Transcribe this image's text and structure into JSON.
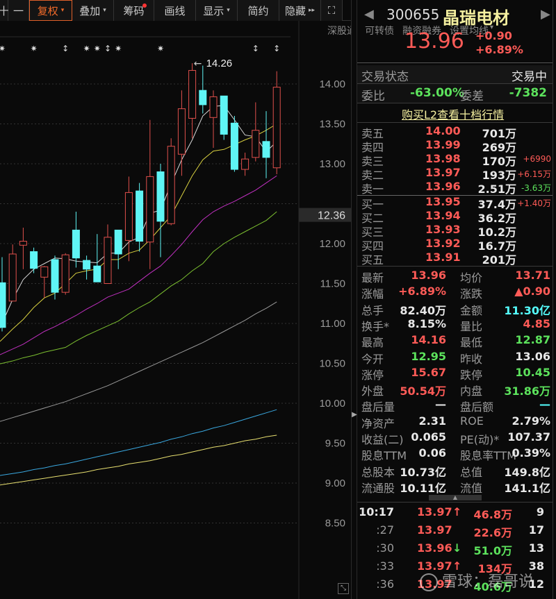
{
  "toolbar": {
    "items": [
      {
        "label": "十"
      },
      {
        "label": "一"
      },
      {
        "label": "复权",
        "caret": "▾"
      },
      {
        "label": "叠加",
        "caret": "▾"
      },
      {
        "label": "筹码"
      },
      {
        "label": "画线"
      },
      {
        "label": "显示",
        "caret": "▾"
      },
      {
        "label": "简约"
      },
      {
        "label": "隐藏",
        "caret": "▸▸"
      }
    ],
    "fullscreen_icon": "⛶"
  },
  "subbar": {
    "items": [
      "深股通",
      "可转债",
      "融资融券",
      "设置均线"
    ],
    "caret": "▾"
  },
  "chart_data": {
    "type": "candlestick",
    "y_ticks": [
      "14.00",
      "13.50",
      "13.00",
      "12.00",
      "11.50",
      "11.00",
      "10.50",
      "10.00",
      "9.50",
      "9.00",
      "8.50"
    ],
    "y_tick_values": [
      14,
      13.5,
      13,
      12,
      11.5,
      11,
      10.5,
      10,
      9.5,
      9,
      8.5
    ],
    "current_price_label": "12.36",
    "current_price": 12.36,
    "high_annotation": "14.26",
    "high_value": 14.26,
    "candles": [
      [
        11.51,
        10.95,
        11.83,
        10.9
      ],
      [
        11.28,
        11.87,
        11.99,
        11.28
      ],
      [
        11.98,
        12.03,
        12.2,
        11.68
      ],
      [
        11.9,
        11.69,
        11.95,
        11.63
      ],
      [
        11.58,
        11.71,
        11.72,
        11.32
      ],
      [
        11.8,
        11.39,
        11.85,
        11.3
      ],
      [
        11.39,
        11.86,
        11.88,
        11.36
      ],
      [
        12.17,
        11.82,
        12.4,
        11.7
      ],
      [
        11.79,
        11.68,
        11.85,
        11.55
      ],
      [
        11.72,
        11.52,
        12.12,
        11.52
      ],
      [
        11.5,
        12.08,
        12.24,
        11.5
      ],
      [
        12.17,
        11.87,
        12.17,
        11.68
      ],
      [
        12.04,
        12.64,
        12.84,
        11.78
      ],
      [
        12.66,
        12.03,
        12.76,
        11.9
      ],
      [
        12.02,
        12.84,
        13.55,
        11.68
      ],
      [
        12.9,
        12.28,
        13.0,
        11.83
      ],
      [
        12.25,
        13.22,
        13.32,
        12.23
      ],
      [
        13.12,
        13.69,
        13.92,
        12.85
      ],
      [
        13.57,
        14.17,
        14.26,
        13.32
      ],
      [
        13.92,
        13.74,
        14.23,
        13.63
      ],
      [
        13.58,
        13.84,
        13.92,
        13.2
      ],
      [
        13.85,
        13.37,
        13.85,
        13.3
      ],
      [
        13.51,
        12.93,
        13.6,
        12.9
      ],
      [
        12.93,
        13.06,
        13.14,
        12.85
      ],
      [
        13.08,
        13.42,
        13.77,
        13.03
      ],
      [
        13.28,
        13.08,
        13.66,
        12.82
      ],
      [
        12.95,
        13.96,
        14.16,
        12.87
      ]
    ],
    "ma": [
      {
        "name": "MA5",
        "color": "#d8d8d8",
        "values": [
          11.0,
          11.3,
          11.55,
          11.68,
          11.75,
          11.82,
          11.81,
          11.78,
          11.77,
          11.76,
          11.88,
          11.88,
          12.02,
          12.08,
          12.38,
          12.42,
          12.75,
          13.05,
          13.3,
          13.6,
          13.72,
          13.73,
          13.55,
          13.36,
          13.34,
          13.15,
          13.28
        ]
      },
      {
        "name": "MA10",
        "color": "#d8d040",
        "values": [
          10.8,
          10.93,
          11.05,
          11.2,
          11.32,
          11.38,
          11.5,
          11.63,
          11.66,
          11.68,
          11.8,
          11.8,
          11.88,
          11.92,
          12.05,
          12.2,
          12.35,
          12.6,
          12.85,
          13.05,
          13.16,
          13.18,
          13.24,
          13.3,
          13.35,
          13.42,
          13.5
        ]
      },
      {
        "name": "MA20",
        "color": "#c030c0",
        "values": [
          10.62,
          10.68,
          10.74,
          10.82,
          10.9,
          10.96,
          11.03,
          11.1,
          11.18,
          11.25,
          11.33,
          11.38,
          11.43,
          11.53,
          11.63,
          11.72,
          11.85,
          11.99,
          12.15,
          12.3,
          12.4,
          12.47,
          12.53,
          12.6,
          12.67,
          12.76,
          12.85
        ]
      },
      {
        "name": "MA30",
        "color": "#7cc030",
        "values": [
          10.5,
          10.53,
          10.57,
          10.6,
          10.64,
          10.67,
          10.7,
          10.78,
          10.85,
          10.91,
          10.97,
          11.03,
          11.12,
          11.2,
          11.27,
          11.37,
          11.47,
          11.55,
          11.66,
          11.75,
          11.9,
          12.0,
          12.08,
          12.15,
          12.22,
          12.29,
          12.4
        ]
      },
      {
        "name": "MA60",
        "color": "#9a9a9a",
        "values": [
          9.78,
          9.82,
          9.86,
          9.9,
          9.94,
          9.98,
          10.02,
          10.07,
          10.12,
          10.17,
          10.22,
          10.28,
          10.34,
          10.4,
          10.46,
          10.52,
          10.58,
          10.64,
          10.7,
          10.76,
          10.83,
          10.9,
          10.97,
          11.04,
          11.12,
          11.19,
          11.27
        ]
      },
      {
        "name": "MA120",
        "color": "#3aa8e0",
        "values": [
          9.1,
          9.12,
          9.14,
          9.17,
          9.19,
          9.22,
          9.24,
          9.27,
          9.3,
          9.33,
          9.36,
          9.39,
          9.42,
          9.45,
          9.48,
          9.51,
          9.55,
          9.58,
          9.62,
          9.65,
          9.69,
          9.72,
          9.76,
          9.8,
          9.84,
          9.88,
          9.92
        ]
      },
      {
        "name": "MA250",
        "color": "#e8e070",
        "values": [
          8.98,
          9.0,
          9.02,
          9.04,
          9.06,
          9.08,
          9.1,
          9.12,
          9.14,
          9.17,
          9.19,
          9.21,
          9.24,
          9.26,
          9.28,
          9.31,
          9.34,
          9.36,
          9.39,
          9.42,
          9.45,
          9.47,
          9.5,
          9.53,
          9.55,
          9.58,
          9.6
        ]
      }
    ],
    "markers": [
      {
        "i": 0,
        "s": "✷"
      },
      {
        "i": 3,
        "s": "✷"
      },
      {
        "i": 6,
        "s": "↕"
      },
      {
        "i": 8,
        "s": "✷"
      },
      {
        "i": 9,
        "s": "✷"
      },
      {
        "i": 10,
        "s": "↕"
      },
      {
        "i": 11,
        "s": "✷"
      },
      {
        "i": 15,
        "s": "✷"
      },
      {
        "i": 24,
        "s": "↕"
      },
      {
        "i": 26,
        "s": "↕"
      }
    ],
    "up_color": "#e0504c",
    "down_color": "#5ff5f5"
  },
  "quote": {
    "code": "300655",
    "name": "晶瑞电材",
    "price": "13.96",
    "change": "+0.90",
    "change_pct": "+6.89%",
    "prev_icon": "◀",
    "next_icon": "▶"
  },
  "status": {
    "label": "交易状态",
    "value": "交易中"
  },
  "weibi": {
    "label": "委比",
    "value": "-63.00%",
    "diff_label": "委差",
    "diff_value": "-7382"
  },
  "l2_link": "购买L2查看十档行情",
  "orderbook": {
    "asks": [
      {
        "label": "卖五",
        "price": "14.00",
        "vol": "701万",
        "chg": ""
      },
      {
        "label": "卖四",
        "price": "13.99",
        "vol": "269万",
        "chg": ""
      },
      {
        "label": "卖三",
        "price": "13.98",
        "vol": "170万",
        "chg": "+6990"
      },
      {
        "label": "卖二",
        "price": "13.97",
        "vol": "193万",
        "chg": "+6.15万"
      },
      {
        "label": "卖一",
        "price": "13.96",
        "vol": "2.51万",
        "chg": "-3.63万"
      }
    ],
    "bids": [
      {
        "label": "买一",
        "price": "13.95",
        "vol": "37.4万",
        "chg": "+1.40万"
      },
      {
        "label": "买二",
        "price": "13.94",
        "vol": "36.2万",
        "chg": ""
      },
      {
        "label": "买三",
        "price": "13.93",
        "vol": "10.2万",
        "chg": ""
      },
      {
        "label": "买四",
        "price": "13.92",
        "vol": "16.7万",
        "chg": ""
      },
      {
        "label": "买五",
        "price": "13.91",
        "vol": "201万",
        "chg": ""
      }
    ]
  },
  "stats": [
    [
      "最新",
      "13.96",
      "red",
      "均价",
      "13.71",
      "red"
    ],
    [
      "涨幅",
      "+6.89%",
      "red",
      "涨跌",
      "▲0.90",
      "red"
    ],
    [
      "总手",
      "82.40万",
      "wh",
      "金额",
      "11.30亿",
      "cy"
    ],
    [
      "换手*",
      "8.15%",
      "wh",
      "量比",
      "4.85",
      "red"
    ],
    [
      "最高",
      "14.16",
      "red",
      "最低",
      "12.87",
      "grn"
    ],
    [
      "今开",
      "12.95",
      "grn",
      "昨收",
      "13.06",
      "wh"
    ],
    [
      "涨停",
      "15.67",
      "red",
      "跌停",
      "10.45",
      "grn"
    ],
    [
      "外盘",
      "50.54万",
      "red",
      "内盘",
      "31.86万",
      "grn"
    ],
    [
      "盘后量",
      "—",
      "wh",
      "盘后额",
      "—",
      "cy"
    ],
    [
      "净资产",
      "2.31",
      "wh",
      "ROE",
      "2.79%",
      "wh"
    ],
    [
      "收益(二)",
      "0.065",
      "wh",
      "PE(动)*",
      "107.37",
      "wh"
    ],
    [
      "股息TTM",
      "0.06",
      "wh",
      "股息率TTM",
      "0.39%",
      "wh"
    ],
    [
      "总股本",
      "10.73亿",
      "wh",
      "总值",
      "149.8亿",
      "wh"
    ],
    [
      "流通股",
      "10.11亿",
      "wh",
      "流值",
      "141.1亿",
      "wh"
    ]
  ],
  "trades": [
    {
      "time": "10:17",
      "price": "13.97",
      "arrow": "↑",
      "vol": "46.8万",
      "vc": "red",
      "n": "9"
    },
    {
      "time": ":27",
      "price": "13.97",
      "arrow": "",
      "vol": "22.6万",
      "vc": "red",
      "n": "17"
    },
    {
      "time": ":30",
      "price": "13.96",
      "arrow": "↓",
      "vol": "51.0万",
      "vc": "grn",
      "n": "13"
    },
    {
      "time": ":33",
      "price": "13.97",
      "arrow": "↑",
      "vol": "134万",
      "vc": "red",
      "n": "38"
    },
    {
      "time": ":36",
      "price": "13.97",
      "arrow": "",
      "vol": "40.6万",
      "vc": "grn",
      "n": "12"
    }
  ],
  "watermark": "雪球：磊哥说"
}
